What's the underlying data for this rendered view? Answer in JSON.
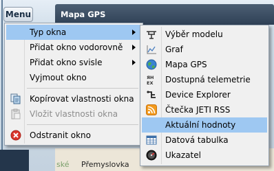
{
  "app": {
    "menu_button": "Menu",
    "window_title": "Mapa GPS",
    "map_street": "Přemyslovka",
    "map_fragment": "ské"
  },
  "main_menu": {
    "items": [
      {
        "label": "Typ okna",
        "submenu": true,
        "highlighted": true
      },
      {
        "label": "Přidat okno vodorovně",
        "submenu": true
      },
      {
        "label": "Přidat okno svisle",
        "submenu": true
      },
      {
        "label": "Vyjmout okno"
      },
      {
        "label": "Kopírovat vlastnosti okna",
        "icon": "copy-icon"
      },
      {
        "label": "Vložit vlastnosti okna",
        "icon": "paste-icon",
        "disabled": true
      },
      {
        "label": "Odstranit okno",
        "icon": "delete-icon"
      }
    ]
  },
  "sub_menu": {
    "items": [
      {
        "label": "Výběr modelu",
        "icon": "model-select-icon"
      },
      {
        "label": "Graf",
        "icon": "chart-icon"
      },
      {
        "label": "Mapa GPS",
        "icon": "globe-icon"
      },
      {
        "label": "Dostupná telemetrie",
        "icon": "telemetry-icon",
        "icon_text": "ЯН EX"
      },
      {
        "label": "Device Explorer",
        "icon": "device-explorer-icon"
      },
      {
        "label": "Čtečka JETI RSS",
        "icon": "rss-icon"
      },
      {
        "label": "Aktuální hodnoty",
        "highlighted": true
      },
      {
        "label": "Datová tabulka",
        "icon": "table-icon"
      },
      {
        "label": "Ukazatel",
        "icon": "gauge-icon"
      }
    ]
  },
  "colors": {
    "highlight": "#9ec8f2",
    "title_bar": "#34465a",
    "delete_red": "#d9362b",
    "rss_orange": "#f39a1d"
  }
}
